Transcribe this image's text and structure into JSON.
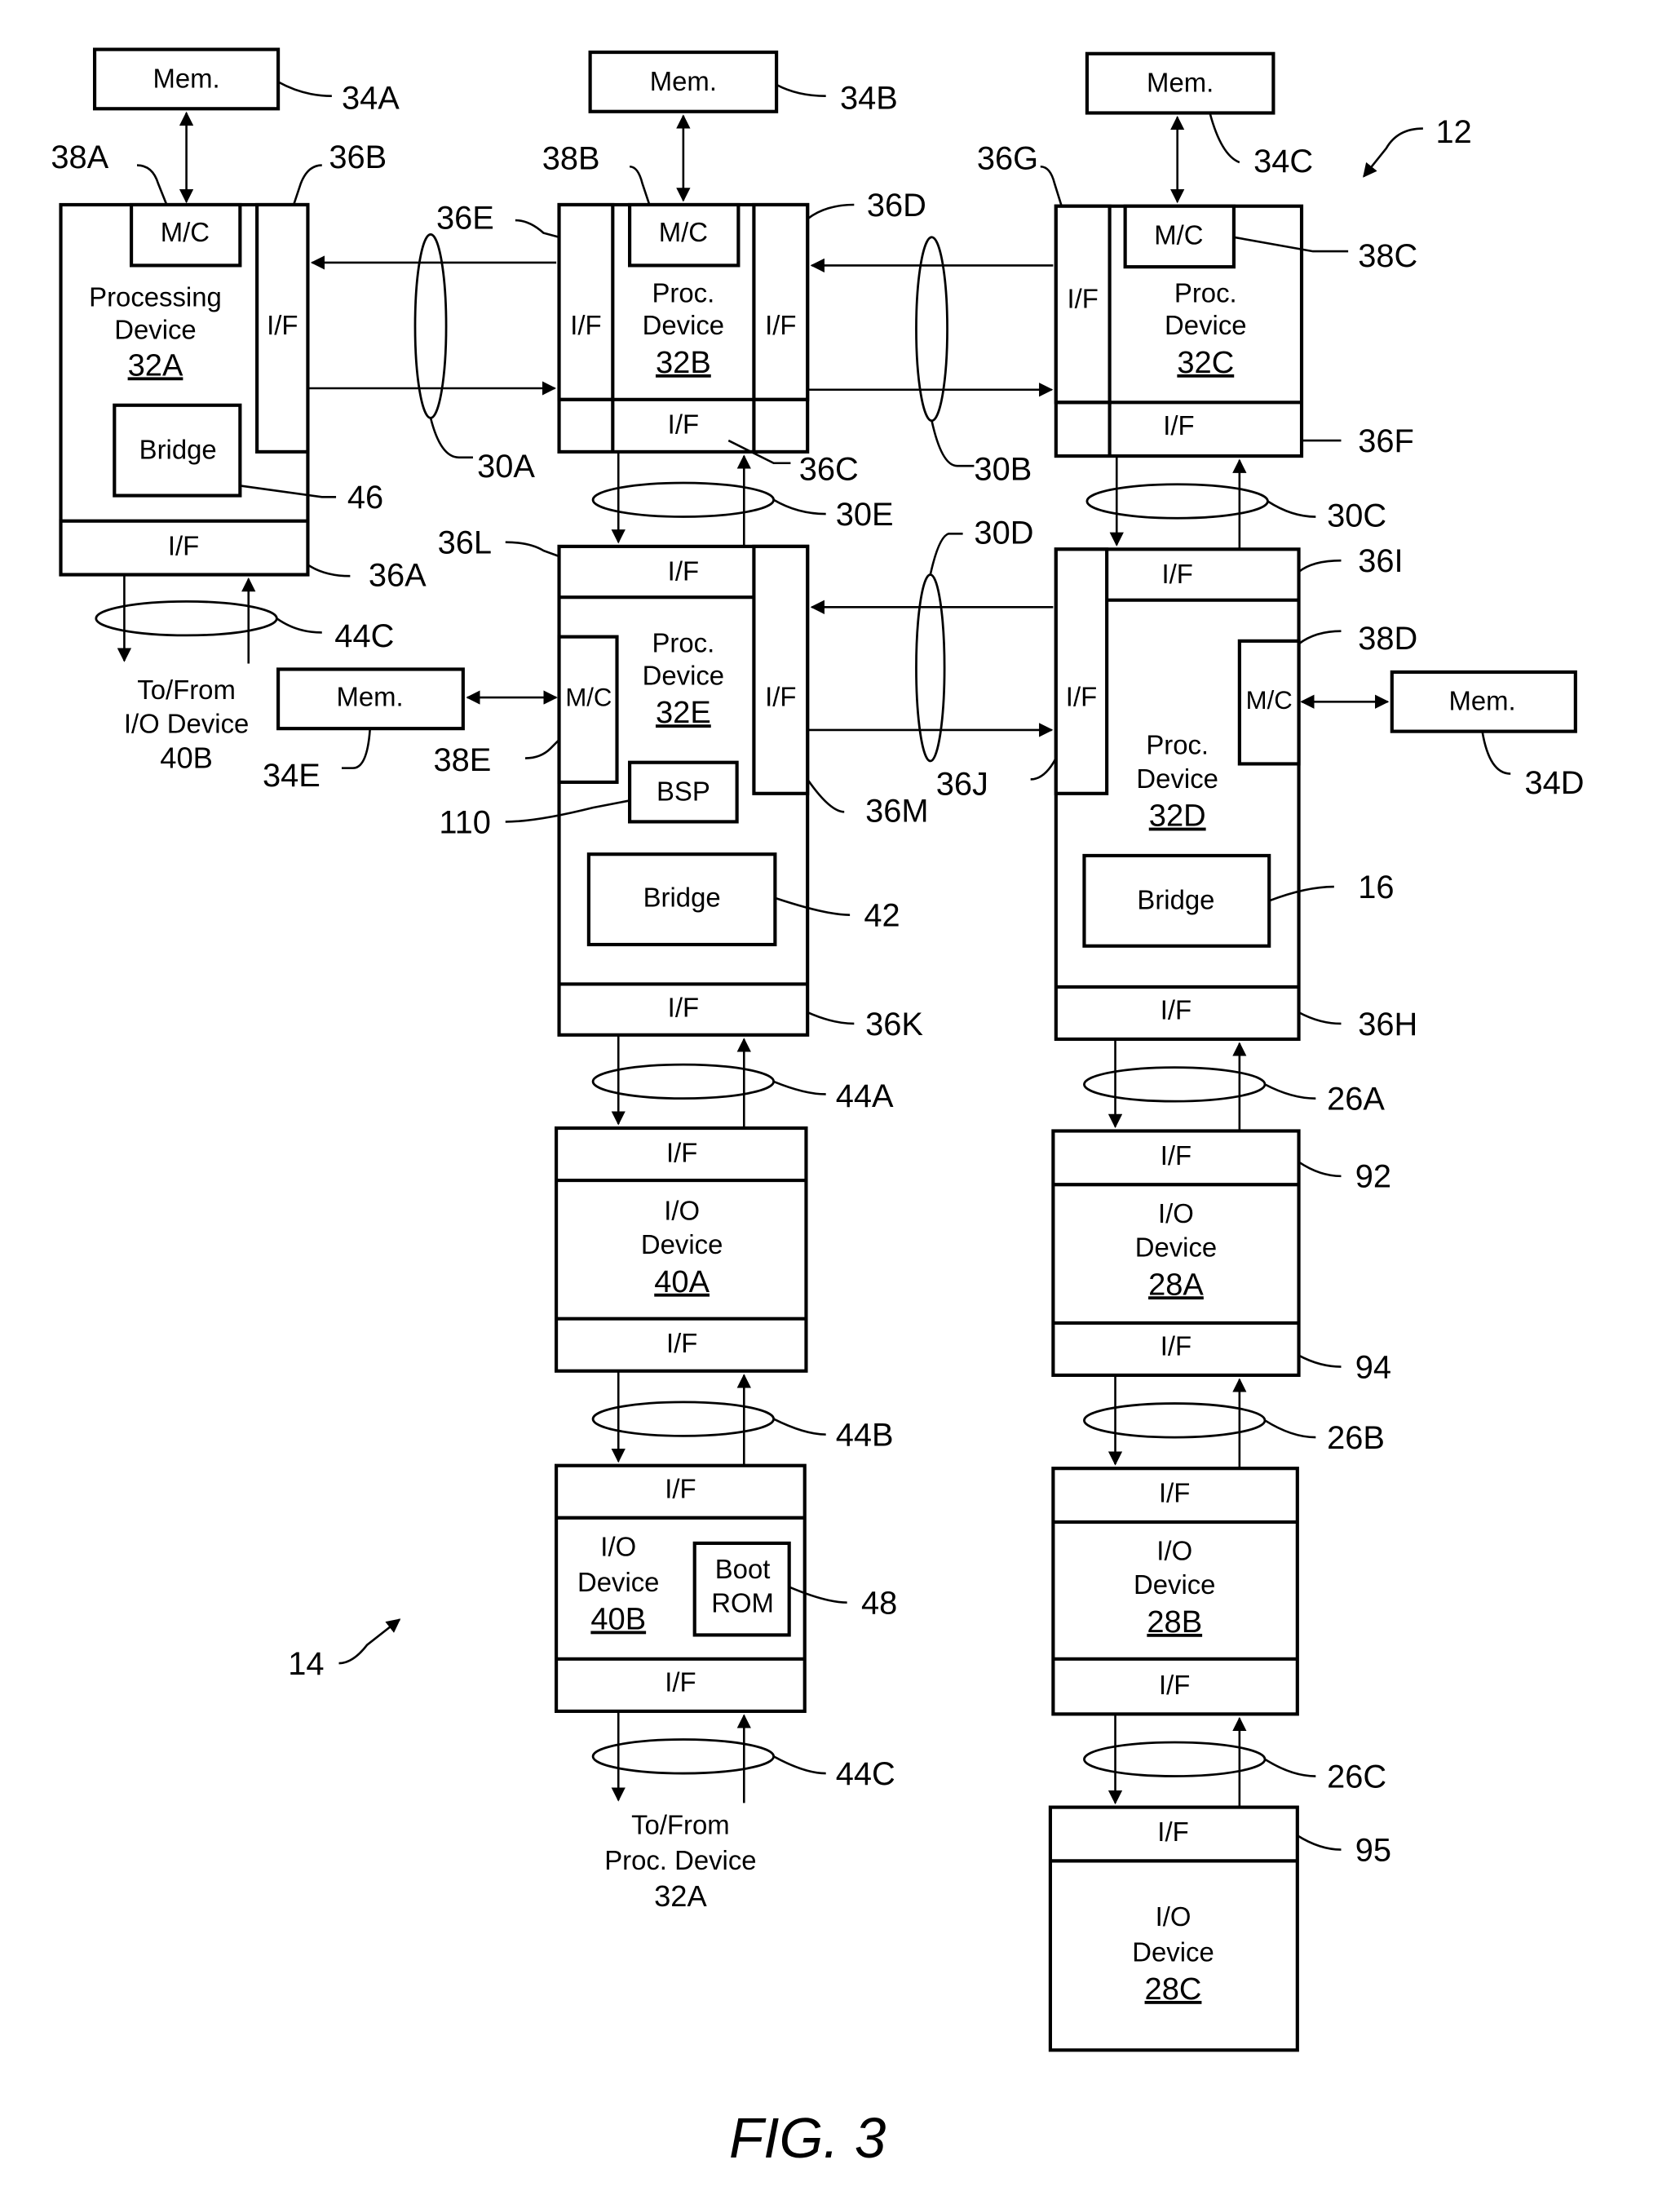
{
  "figure": {
    "caption": "FIG. 3",
    "system_ref": "12",
    "io_subsystem_ref": "14"
  },
  "labels": {
    "mem": "Mem.",
    "mc": "M/C",
    "if": "I/F",
    "proc": "Proc.",
    "processing": "Processing",
    "device": "Device",
    "bridge": "Bridge",
    "bsp": "BSP",
    "io": "I/O",
    "boot": "Boot",
    "rom": "ROM"
  },
  "processing_devices": {
    "p32A": {
      "id": "32A"
    },
    "p32B": {
      "id": "32B"
    },
    "p32C": {
      "id": "32C"
    },
    "p32D": {
      "id": "32D"
    },
    "p32E": {
      "id": "32E"
    }
  },
  "io_devices": {
    "d40A": {
      "id": "40A"
    },
    "d40B": {
      "id": "40B"
    },
    "d28A": {
      "id": "28A"
    },
    "d28B": {
      "id": "28B"
    },
    "d28C": {
      "id": "28C"
    }
  },
  "external_links": {
    "to_io_40b": {
      "line1": "To/From",
      "line2": "I/O Device",
      "line3": "40B"
    },
    "to_proc_32a": {
      "line1": "To/From",
      "line2": "Proc. Device",
      "line3": "32A"
    }
  },
  "refs": {
    "r34A": "34A",
    "r34B": "34B",
    "r34C": "34C",
    "r34D": "34D",
    "r34E": "34E",
    "r38A": "38A",
    "r38B": "38B",
    "r38C": "38C",
    "r38D": "38D",
    "r38E": "38E",
    "r36A": "36A",
    "r36B": "36B",
    "r36C": "36C",
    "r36D": "36D",
    "r36E": "36E",
    "r36F": "36F",
    "r36G": "36G",
    "r36H": "36H",
    "r36I": "36I",
    "r36J": "36J",
    "r36K": "36K",
    "r36L": "36L",
    "r36M": "36M",
    "r30A": "30A",
    "r30B": "30B",
    "r30C": "30C",
    "r30D": "30D",
    "r30E": "30E",
    "r44A": "44A",
    "r44B": "44B",
    "r44C_top": "44C",
    "r44C_bottom": "44C",
    "r26A": "26A",
    "r26B": "26B",
    "r26C": "26C",
    "r46": "46",
    "r42": "42",
    "r16": "16",
    "r110": "110",
    "r48": "48",
    "r92": "92",
    "r94": "94",
    "r95": "95"
  }
}
